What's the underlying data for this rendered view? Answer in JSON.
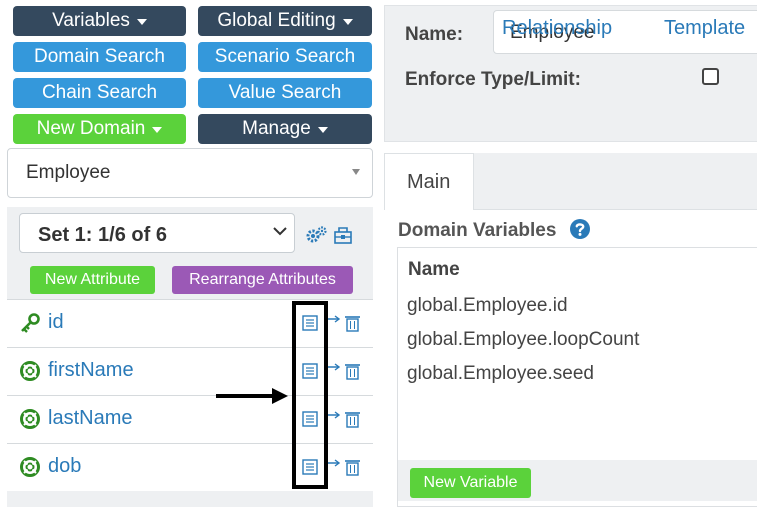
{
  "toolbar": {
    "variables_label": "Variables",
    "global_editing_label": "Global Editing",
    "domain_search_label": "Domain Search",
    "scenario_search_label": "Scenario Search",
    "chain_search_label": "Chain Search",
    "value_search_label": "Value Search",
    "new_domain_label": "New Domain",
    "manage_label": "Manage"
  },
  "domain_select": {
    "value": "Employee"
  },
  "set_select": {
    "value": "Set 1: 1/6 of 6"
  },
  "attribute_buttons": {
    "new_attribute": "New Attribute",
    "rearrange_attributes": "Rearrange Attributes"
  },
  "attributes": [
    {
      "label": "id",
      "icon": "key-icon"
    },
    {
      "label": "firstName",
      "icon": "lifebuoy-icon"
    },
    {
      "label": "lastName",
      "icon": "lifebuoy-icon"
    },
    {
      "label": "dob",
      "icon": "lifebuoy-icon"
    }
  ],
  "form": {
    "name_label": "Name:",
    "name_value": "Employee",
    "enforce_label": "Enforce Type/Limit:"
  },
  "tabs": {
    "main": "Main",
    "relationship": "Relationship",
    "template": "Template"
  },
  "domain_variables": {
    "title": "Domain Variables",
    "column_name": "Name",
    "rows": [
      "global.Employee.id",
      "global.Employee.loopCount",
      "global.Employee.seed"
    ],
    "new_variable_label": "New Variable"
  },
  "colors": {
    "dark_button": "#34495e",
    "blue_button": "#3498db",
    "green_button": "#5bd23b",
    "purple_button": "#9b59b6",
    "link": "#2a7ab8"
  }
}
